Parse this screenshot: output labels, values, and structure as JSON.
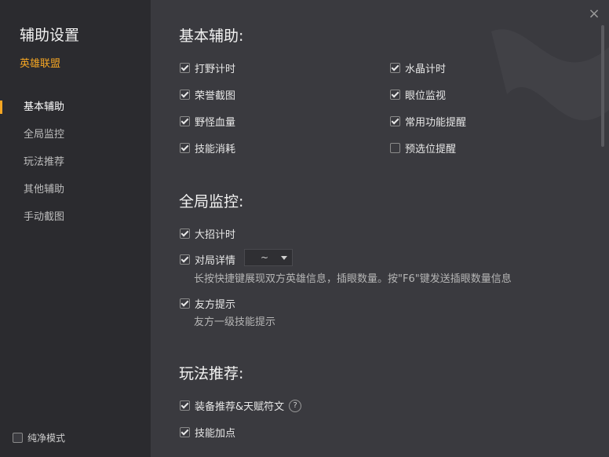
{
  "sidebar": {
    "title": "辅助设置",
    "subtitle": "英雄联盟",
    "items": [
      {
        "label": "基本辅助",
        "active": true
      },
      {
        "label": "全局监控",
        "active": false
      },
      {
        "label": "玩法推荐",
        "active": false
      },
      {
        "label": "其他辅助",
        "active": false
      },
      {
        "label": "手动截图",
        "active": false
      }
    ],
    "pure_mode": {
      "label": "纯净模式",
      "checked": false
    }
  },
  "window": {
    "close_icon": "×"
  },
  "basic": {
    "title": "基本辅助:",
    "options": [
      {
        "label": "打野计时",
        "checked": true
      },
      {
        "label": "水晶计时",
        "checked": true
      },
      {
        "label": "荣誉截图",
        "checked": true
      },
      {
        "label": "眼位监视",
        "checked": true
      },
      {
        "label": "野怪血量",
        "checked": true
      },
      {
        "label": "常用功能提醒",
        "checked": true
      },
      {
        "label": "技能消耗",
        "checked": true
      },
      {
        "label": "预选位提醒",
        "checked": false
      }
    ]
  },
  "global": {
    "title": "全局监控:",
    "ult_timer": {
      "label": "大招计时",
      "checked": true
    },
    "match_detail": {
      "label": "对局详情",
      "checked": true,
      "select_value": "~",
      "desc": "长按快捷键展现双方英雄信息，插眼数量。按\"F6\"键发送插眼数量信息"
    },
    "ally_tip": {
      "label": "友方提示",
      "checked": true,
      "desc": "友方一级技能提示"
    }
  },
  "recommend": {
    "title": "玩法推荐:",
    "equip": {
      "label": "装备推荐&天赋符文",
      "checked": true,
      "help": "?"
    },
    "skill": {
      "label": "技能加点",
      "checked": true
    }
  }
}
